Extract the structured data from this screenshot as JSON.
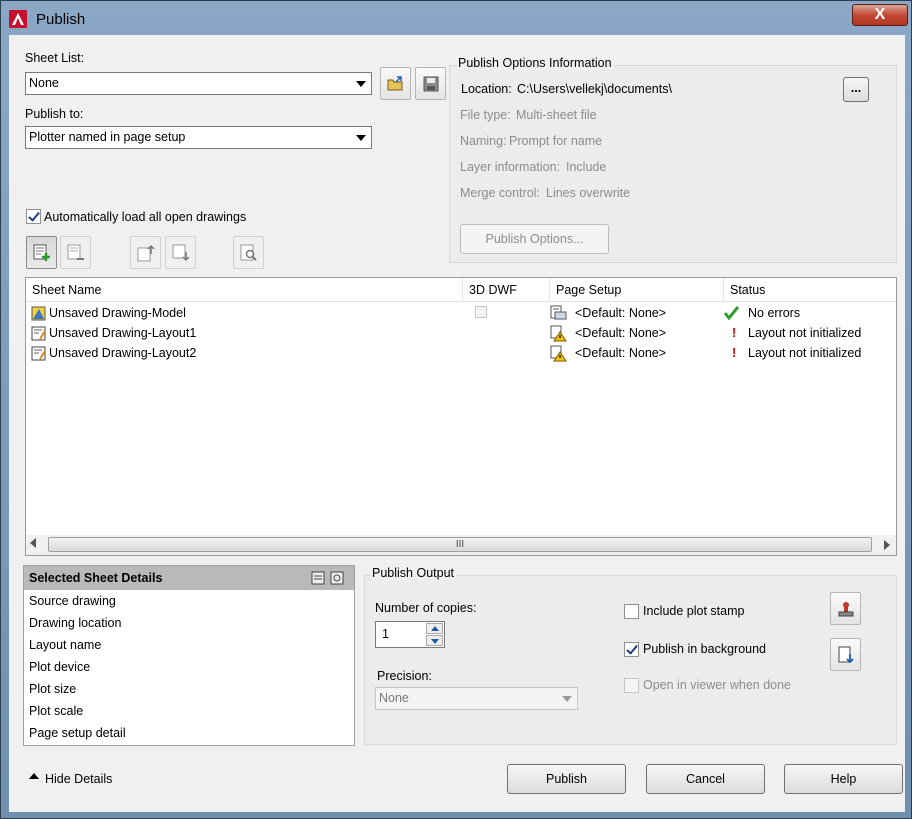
{
  "window": {
    "title": "Publish",
    "close_label": "X"
  },
  "sheet_list": {
    "label": "Sheet List:",
    "value": "None"
  },
  "publish_to": {
    "label": "Publish to:",
    "value": "Plotter named in page setup"
  },
  "auto_load": {
    "label": "Automatically load all open drawings",
    "checked": true
  },
  "options_info": {
    "title": "Publish Options Information",
    "location_label": "Location:",
    "location_value": "C:\\Users\\vellekj\\documents\\",
    "browse_label": "...",
    "file_type_label": "File type:",
    "file_type_value": "Multi-sheet file",
    "naming_label": "Naming:",
    "naming_value": "Prompt for name",
    "layer_label": "Layer information:",
    "layer_value": "Include",
    "merge_label": "Merge control:",
    "merge_value": "Lines overwrite",
    "button_label": "Publish Options..."
  },
  "table": {
    "columns": [
      "Sheet Name",
      "3D DWF",
      "Page Setup",
      "Status"
    ],
    "rows": [
      {
        "name": "Unsaved Drawing-Model",
        "page_setup": "<Default: None>",
        "status": "No errors",
        "status_type": "ok"
      },
      {
        "name": "Unsaved Drawing-Layout1",
        "page_setup": "<Default: None>",
        "status": "Layout not initialized",
        "status_type": "warn"
      },
      {
        "name": "Unsaved Drawing-Layout2",
        "page_setup": "<Default: None>",
        "status": "Layout not initialized",
        "status_type": "warn"
      }
    ],
    "scroll_grip": "III"
  },
  "details": {
    "title": "Selected Sheet Details",
    "items": [
      "Source drawing",
      "Drawing location",
      "Layout name",
      "Plot device",
      "Plot size",
      "Plot scale",
      "Page setup detail"
    ]
  },
  "publish_output": {
    "title": "Publish Output",
    "copies_label": "Number of copies:",
    "copies_value": "1",
    "precision_label": "Precision:",
    "precision_value": "None",
    "plot_stamp_label": "Include plot stamp",
    "background_label": "Publish in background",
    "viewer_label": "Open in viewer when done"
  },
  "footer": {
    "hide_details": "Hide Details",
    "publish": "Publish",
    "cancel": "Cancel",
    "help": "Help"
  }
}
